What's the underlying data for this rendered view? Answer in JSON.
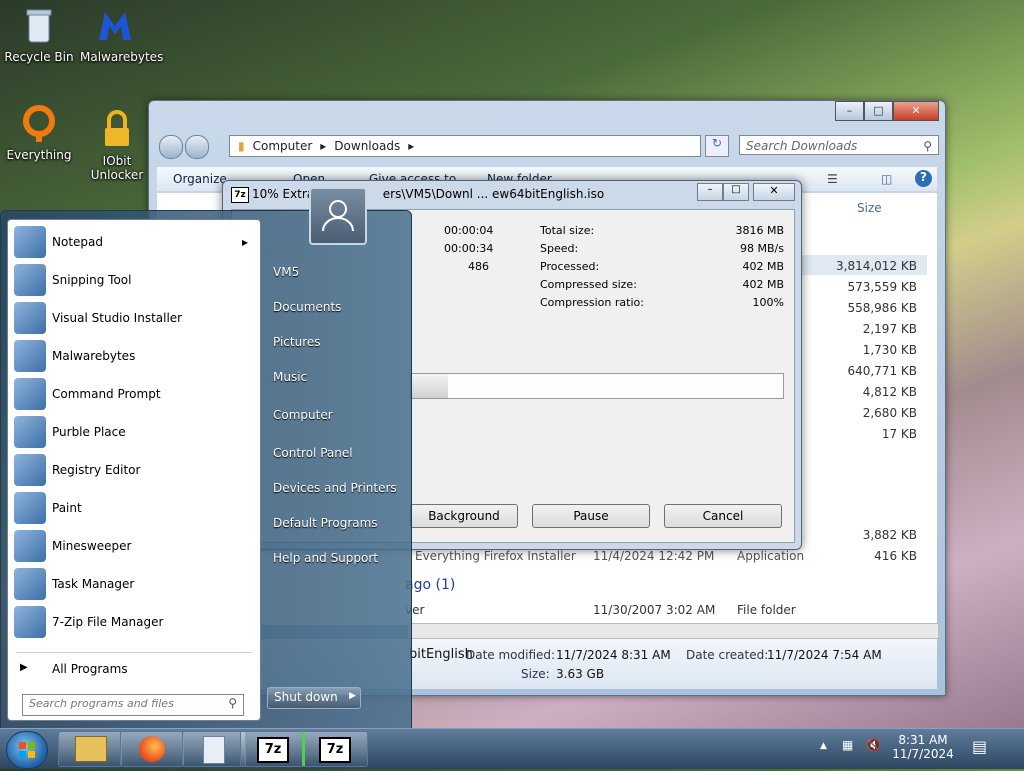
{
  "desktop": {
    "icons": [
      {
        "label": "Recycle Bin",
        "icon": "recycle-bin-icon"
      },
      {
        "label": "Malwarebytes",
        "icon": "malwarebytes-icon"
      },
      {
        "label": "Everything",
        "icon": "everything-icon"
      },
      {
        "label": "IObit Unlocker",
        "icon": "iobit-unlocker-icon"
      }
    ]
  },
  "explorer": {
    "breadcrumb": [
      "Computer",
      "Downloads"
    ],
    "search_placeholder": "Search Downloads",
    "toolbar": {
      "organize": "Organize",
      "open": "Open",
      "give_access": "Give access to",
      "new_folder": "New folder"
    },
    "size_header": "Size",
    "sizes": [
      "3,814,012 KB",
      "573,559 KB",
      "558,986 KB",
      "2,197 KB",
      "1,730 KB",
      "640,771 KB",
      "4,812 KB",
      "2,680 KB",
      "17 KB"
    ],
    "lower_sizes": [
      "3,882 KB",
      "416 KB"
    ],
    "partial_row": {
      "name": "Everything Firefox Installer",
      "date": "11/4/2024 12:42 PM",
      "type": "Application"
    },
    "group_header": "ago (1)",
    "folder_row": {
      "name": "ver",
      "date": "11/30/2007 3:02 AM",
      "type": "File folder"
    },
    "details": {
      "name": "bitEnglish",
      "date_modified_label": "Date modified:",
      "date_modified": "11/7/2024 8:31 AM",
      "date_created_label": "Date created:",
      "date_created": "11/7/2024 7:54 AM",
      "size_label": "Size:",
      "size": "3.63 GB"
    }
  },
  "zip_dialog": {
    "title_left": "10% Extrac",
    "title_right": "ers\\VM5\\Downl ... ew64bitEnglish.iso",
    "elapsed": "00:00:04",
    "remaining": "00:00:34",
    "files": "486",
    "stats": [
      {
        "label": "Total size:",
        "value": "3816 MB"
      },
      {
        "label": "Speed:",
        "value": "98 MB/s"
      },
      {
        "label": "Processed:",
        "value": "402 MB"
      },
      {
        "label": "Compressed size:",
        "value": "402 MB"
      },
      {
        "label": "Compression ratio:",
        "value": "100%"
      }
    ],
    "progress": 0.1,
    "buttons": {
      "background": "Background",
      "pause": "Pause",
      "cancel": "Cancel"
    }
  },
  "start_menu": {
    "programs": [
      {
        "label": "Notepad",
        "icon": "notepad-icon",
        "has_arrow": true
      },
      {
        "label": "Snipping Tool",
        "icon": "snipping-tool-icon"
      },
      {
        "label": "Visual Studio Installer",
        "icon": "visual-studio-installer-icon"
      },
      {
        "label": "Malwarebytes",
        "icon": "malwarebytes-icon"
      },
      {
        "label": "Command Prompt",
        "icon": "command-prompt-icon"
      },
      {
        "label": "Purble Place",
        "icon": "purble-place-icon"
      },
      {
        "label": "Registry Editor",
        "icon": "registry-editor-icon"
      },
      {
        "label": "Paint",
        "icon": "paint-icon"
      },
      {
        "label": "Minesweeper",
        "icon": "minesweeper-icon"
      },
      {
        "label": "Task Manager",
        "icon": "task-manager-icon"
      },
      {
        "label": "7-Zip File Manager",
        "icon": "7zip-icon"
      }
    ],
    "all_programs": "All Programs",
    "search_placeholder": "Search programs and files",
    "right_items": [
      "VM5",
      "Documents",
      "Pictures",
      "Music",
      "Computer",
      "Control Panel",
      "Devices and Printers",
      "Default Programs",
      "Help and Support"
    ],
    "shutdown": "Shut down"
  },
  "taskbar": {
    "items": [
      "windows-explorer-icon",
      "firefox-icon",
      "notepad-file-icon",
      "7zip-icon",
      "7zip-icon"
    ],
    "clock_time": "8:31 AM",
    "clock_date": "11/7/2024"
  },
  "colors": {
    "accent": "#2a6fb0",
    "progress_fill": "#e6e6e6"
  }
}
